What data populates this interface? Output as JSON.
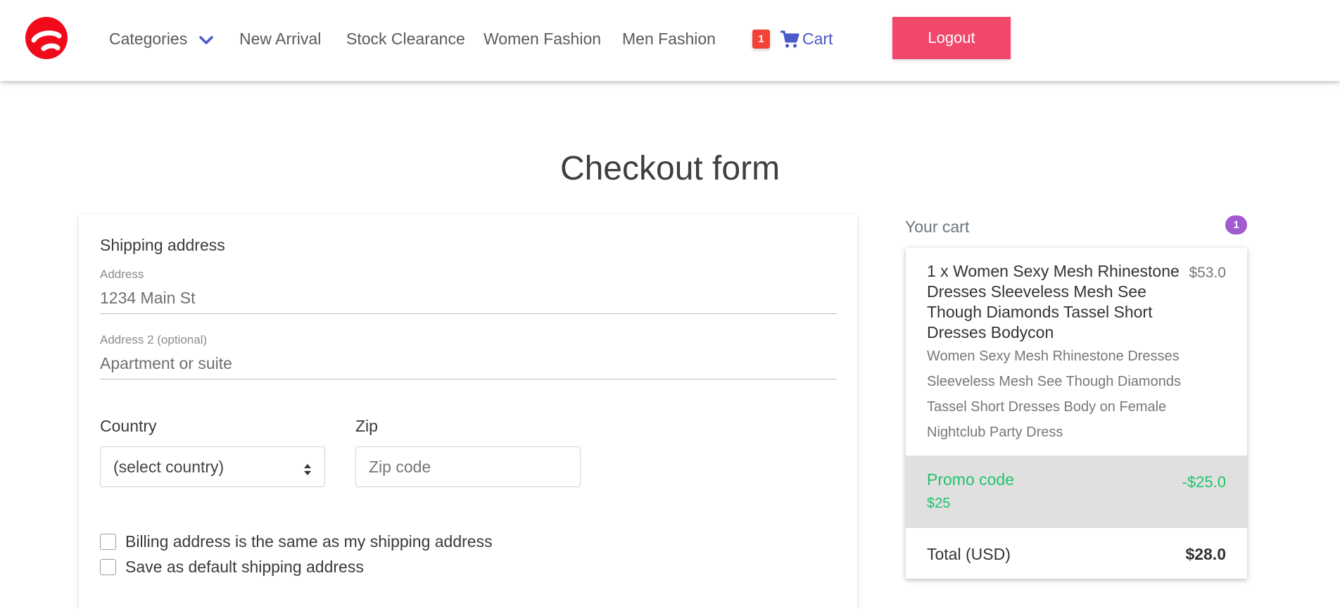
{
  "nav": {
    "logo_icon": "brand-logo-icon",
    "categories": "Categories",
    "links": [
      "New Arrival",
      "Stock Clearance",
      "Women Fashion",
      "Men Fashion"
    ],
    "cart_count": "1",
    "cart_label": "Cart",
    "logout": "Logout"
  },
  "page_title": "Checkout form",
  "form": {
    "section_title": "Shipping address",
    "address_label": "Address",
    "address_placeholder": "1234 Main St",
    "address2_label": "Address 2 (optional)",
    "address2_placeholder": "Apartment or suite",
    "country_label": "Country",
    "country_value": "(select country)",
    "zip_label": "Zip",
    "zip_placeholder": "Zip code",
    "billing_same": "Billing address is the same as my shipping address",
    "save_default": "Save as default shipping address"
  },
  "cart": {
    "heading": "Your cart",
    "count": "1",
    "item_title": "1 x Women Sexy Mesh Rhinestone Dresses Sleeveless Mesh See Though Diamonds Tassel Short Dresses Bodycon",
    "item_price": "$53.0",
    "item_desc": "Women Sexy Mesh Rhinestone Dresses Sleeveless Mesh See Though Diamonds Tassel Short Dresses Body on Female Nightclub Party Dress",
    "promo_title": "Promo code",
    "promo_code": "$25",
    "promo_amount": "-$25.0",
    "total_label": "Total (USD)",
    "total_amount": "$28.0"
  },
  "colors": {
    "brand_red": "#f10a1a",
    "logout_pink": "#f0476b",
    "cart_blue": "#4a5ac8",
    "promo_green": "#22c36b",
    "badge_purple": "#a25ad1",
    "badge_red": "#f44336"
  }
}
